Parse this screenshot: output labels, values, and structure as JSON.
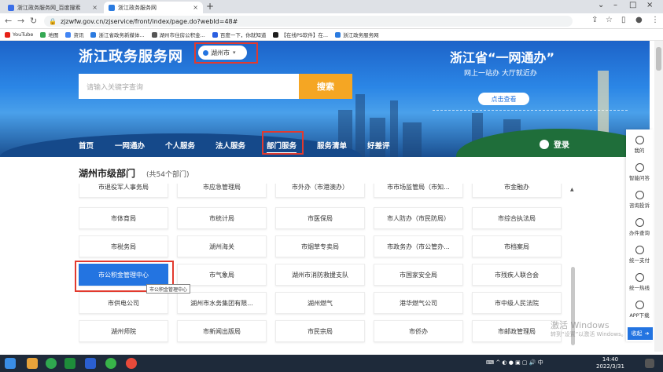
{
  "browser": {
    "tabs": [
      {
        "title": "浙江政务服务网_百度搜索",
        "active": false,
        "color": "#3a6ee8"
      },
      {
        "title": "浙江政务服务网",
        "active": true,
        "color": "#2b7be0"
      }
    ],
    "new_tab": "+",
    "url": "zjzwfw.gov.cn/zjservice/front/index/page.do?webId=48#",
    "bookmarks": [
      {
        "label": "YouTube",
        "color": "#e62117"
      },
      {
        "label": "地图",
        "color": "#34a853"
      },
      {
        "label": "资讯",
        "color": "#4285f4"
      },
      {
        "label": "浙江省政务新媒体...",
        "color": "#2b7be0"
      },
      {
        "label": "湖州市住房公积金...",
        "color": "#555555"
      },
      {
        "label": "百度一下，你就知道",
        "color": "#2b5fe0"
      },
      {
        "label": "【在线PS软件】在...",
        "color": "#1e1e1e"
      },
      {
        "label": "浙江政务服务网",
        "color": "#2b7be0"
      }
    ]
  },
  "header": {
    "site_title": "浙江政务服务网",
    "city": "湖州市",
    "search_placeholder": "请输入关键字查询",
    "search_button": "搜索",
    "slogan_title": "浙江省“一网通办”",
    "slogan_sub": "网上一站办 大厅就近办",
    "check_button": "点击查看",
    "login": "登录"
  },
  "nav": {
    "items": [
      "首页",
      "一网通办",
      "个人服务",
      "法人服务",
      "部门服务",
      "服务清单",
      "好差评"
    ],
    "active_index": 4
  },
  "departments": {
    "title": "湖州市级部门",
    "count": "(共54个部门)",
    "cells": [
      "市退役军人事务局",
      "市应急管理局",
      "市外办（市港澳办）",
      "市市场监管局（市知...",
      "市金融办",
      "市体育局",
      "市统计局",
      "市医保局",
      "市人防办（市民防局）",
      "市综合执法局",
      "市税务局",
      "湖州海关",
      "市烟草专卖局",
      "市政务办（市公管办...",
      "市档案局",
      "市公积金管理中心",
      "市气象局",
      "湖州市消防救援支队",
      "市国家安全局",
      "市残疾人联合会",
      "市供电公司",
      "湖州市水务集团有限...",
      "湖州燃气",
      "港华燃气公司",
      "市中级人民法院",
      "湖州师院",
      "市新闻出版局",
      "市民宗局",
      "市侨办",
      "市邮政管理局"
    ],
    "active_index": 15,
    "tooltip": "市公积金管理中心"
  },
  "sidebar": {
    "items": [
      "我的",
      "智能问答",
      "咨询投诉",
      "办件查询",
      "统一支付",
      "统一热线",
      "APP下载"
    ],
    "collapse": "收起"
  },
  "watermark": {
    "line1": "激活 Windows",
    "line2": "转到“设置”以激活 Windows。"
  },
  "taskbar": {
    "ime": "中",
    "time": "14:40",
    "date": "2022/3/31"
  },
  "colors": {
    "accent": "#2374e1",
    "search_button": "#f5a623",
    "highlight_box": "#e23a2e"
  }
}
